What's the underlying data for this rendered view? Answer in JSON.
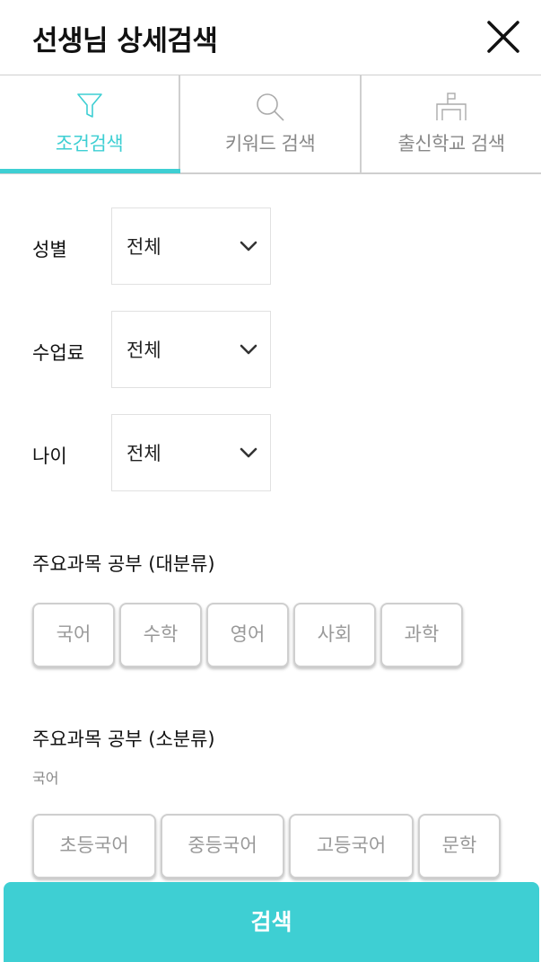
{
  "header": {
    "title": "선생님 상세검색"
  },
  "tabs": [
    {
      "label": "조건검색",
      "icon": "filter-icon",
      "active": true
    },
    {
      "label": "키워드 검색",
      "icon": "search-icon",
      "active": false
    },
    {
      "label": "출신학교 검색",
      "icon": "school-icon",
      "active": false
    }
  ],
  "filters": {
    "gender": {
      "label": "성별",
      "value": "전체"
    },
    "fee": {
      "label": "수업료",
      "value": "전체"
    },
    "age": {
      "label": "나이",
      "value": "전체"
    }
  },
  "major_subjects": {
    "title": "주요과목 공부 (대분류)",
    "chips": [
      "국어",
      "수학",
      "영어",
      "사회",
      "과학"
    ]
  },
  "minor_subjects": {
    "title": "주요과목 공부 (소분류)",
    "category": "국어",
    "chips": [
      "초등국어",
      "중등국어",
      "고등국어",
      "문학"
    ]
  },
  "search_button": {
    "label": "검색"
  },
  "colors": {
    "accent": "#3ecfd3",
    "border": "#cfcfcf",
    "muted": "#999999"
  }
}
